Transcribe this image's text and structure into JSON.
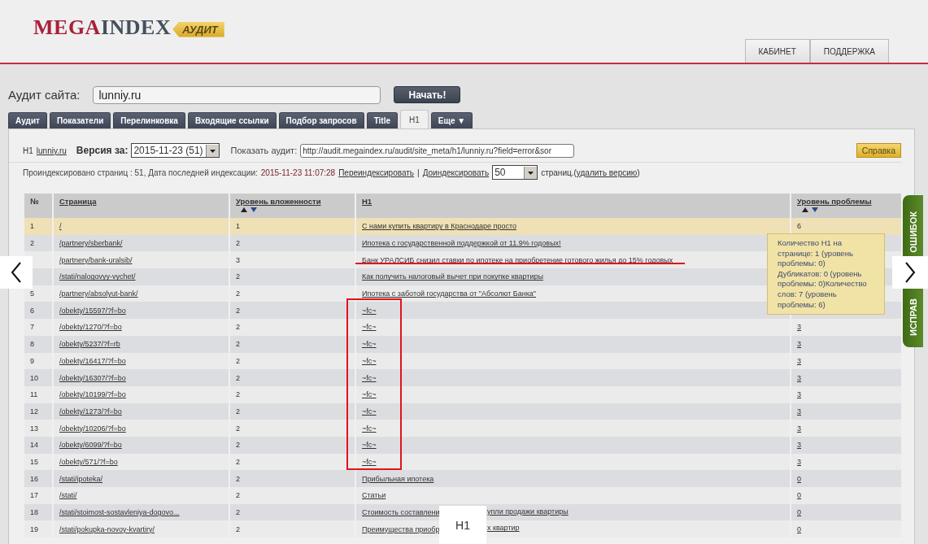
{
  "logo": {
    "part1": "MEGA",
    "part2": "INDEX",
    "badge": "АУДИТ"
  },
  "top_nav": [
    "КАБИНЕТ",
    "ПОДДЕРЖКА"
  ],
  "audit_bar": {
    "label": "Аудит сайта:",
    "value": "lunniy.ru",
    "button": "Начать!"
  },
  "tabs": [
    {
      "label": "Аудит",
      "selected": false
    },
    {
      "label": "Показатели",
      "selected": false
    },
    {
      "label": "Перелинковка",
      "selected": false
    },
    {
      "label": "Входящие ссылки",
      "selected": false
    },
    {
      "label": "Подбор запросов",
      "selected": false
    },
    {
      "label": "Title",
      "selected": false
    },
    {
      "label": "H1",
      "selected": true
    },
    {
      "label": "Еще ▼",
      "selected": false
    }
  ],
  "controls": {
    "prefix": "H1",
    "site_link": "lunniy.ru",
    "version_label": "Версия за:",
    "version_value": "2015-11-23 (51)",
    "show_label": "Показать аудит:",
    "show_value": "http://audit.megaindex.ru/audit/site_meta/h1/lunniy.ru?field=error&sor",
    "help_button": "Справка"
  },
  "index_info": {
    "text": "Проиндексировано страниц : 51, Дата последней индексации:",
    "date": "2015-11-23 11:07:28",
    "reindex_link": "Переиндексировать",
    "separator": "|",
    "addindex_link": "Доиндексировать",
    "pages_value": "50",
    "pages_label": "страниц.(",
    "delete_link": "удалить версию",
    "close_paren": ")"
  },
  "table": {
    "columns": [
      {
        "label": "№",
        "sortable": false,
        "link": false
      },
      {
        "label": "Страница",
        "sortable": false,
        "link": true
      },
      {
        "label": "Уровень вложенности",
        "sortable": true,
        "link": true
      },
      {
        "label": "H1",
        "sortable": false,
        "link": true
      },
      {
        "label": "Уровень проблемы",
        "sortable": true,
        "link": true
      }
    ],
    "rows": [
      {
        "num": "1",
        "page": "/",
        "depth": "1",
        "h1": [
          "С нами купить квартиру в Краснодаре просто"
        ],
        "problem": "6",
        "problem_link": false,
        "highlighted": true
      },
      {
        "num": "2",
        "page": "/partnery/sberbank/",
        "depth": "2",
        "h1": [
          "Ипотека с государственной поддержкой от 11.9% годовых!"
        ],
        "highlighted": false
      },
      {
        "page": "/partnery/bank-uralsib/",
        "depth": "3",
        "h1": [
          "Банк УРАЛСИБ снизил ставки по ипотеке на приобретение готового жилья до 15% годовых"
        ],
        "highlighted": false
      },
      {
        "page": "/stati/nalogovyy-vychet/",
        "depth": "2",
        "h1": [
          "Как получить налоговый вычет при покупке квартиры"
        ],
        "highlighted": false
      },
      {
        "num": "5",
        "page": "/partnery/absolyut-bank/",
        "depth": "2",
        "h1": [
          "Ипотека с заботой государства от \"Абсолют Банка\""
        ],
        "highlighted": false
      },
      {
        "num": "6",
        "page": "/obekty/15597/?f=bo",
        "depth": "2",
        "h1": [
          "~fc~"
        ],
        "highlighted": false
      },
      {
        "num": "7",
        "page": "/obekty/1270/?f=bo",
        "depth": "2",
        "h1": [
          "~fc~"
        ],
        "problem": "3",
        "problem_link": true,
        "highlighted": false
      },
      {
        "num": "8",
        "page": "/obekty/5237/?f=rb",
        "depth": "2",
        "h1": [
          "~fc~"
        ],
        "problem": "3",
        "problem_link": true,
        "highlighted": false
      },
      {
        "num": "9",
        "page": "/obekty/16417/?f=bo",
        "depth": "2",
        "h1": [
          "~fc~"
        ],
        "problem": "3",
        "problem_link": true,
        "highlighted": false
      },
      {
        "num": "10",
        "page": "/obekty/16307/?f=bo",
        "depth": "2",
        "h1": [
          "~fc~"
        ],
        "problem": "3",
        "problem_link": true,
        "highlighted": false
      },
      {
        "num": "11",
        "page": "/obekty/10199/?f=bo",
        "depth": "2",
        "h1": [
          "~fc~"
        ],
        "problem": "3",
        "problem_link": true,
        "highlighted": false
      },
      {
        "num": "12",
        "page": "/obekty/1273/?f=bo",
        "depth": "2",
        "h1": [
          "~fc~"
        ],
        "problem": "3",
        "problem_link": true,
        "highlighted": false
      },
      {
        "num": "13",
        "page": "/obekty/10206/?f=bo",
        "depth": "2",
        "h1": [
          "~fc~"
        ],
        "problem": "3",
        "problem_link": true,
        "highlighted": false
      },
      {
        "num": "14",
        "page": "/obekty/6099/?f=bo",
        "depth": "2",
        "h1": [
          "~fc~"
        ],
        "problem": "3",
        "problem_link": true,
        "highlighted": false
      },
      {
        "num": "15",
        "page": "/obekty/571/?f=bo",
        "depth": "2",
        "h1": [
          "~fc~"
        ],
        "problem": "3",
        "problem_link": true,
        "highlighted": false
      },
      {
        "num": "16",
        "page": "/stati/ipoteka/",
        "depth": "2",
        "h1": [
          "Прибыльная ипотека"
        ],
        "problem": "0",
        "problem_link": true,
        "highlighted": false
      },
      {
        "num": "17",
        "page": "/stati/",
        "depth": "2",
        "h1": [
          "Статьи"
        ],
        "problem": "0",
        "problem_link": true,
        "highlighted": false
      },
      {
        "num": "18",
        "page": "/stati/stoimost-sostavleniya-dogovo...",
        "depth": "2",
        "h1": [
          "Стоимость составлени",
          "упли продажи квартиры"
        ],
        "problem": "0",
        "problem_link": true,
        "highlighted": false
      },
      {
        "num": "19",
        "page": "/stati/pokupka-novoy-kvartiry/",
        "depth": "2",
        "h1": [
          "Преимущества приобр",
          "х квартир"
        ],
        "problem": "0",
        "problem_link": true,
        "highlighted": false
      }
    ]
  },
  "tooltip": "Количество H1 на странице: 1 (уровень проблемы: 0)\nДубликатов: 0 (уровень проблемы: 0)Количество слов: 7 (уровень проблемы: 6)",
  "side_tab": [
    "ИСПРАВ",
    "ОШИБОК"
  ],
  "caption_box": "H1"
}
